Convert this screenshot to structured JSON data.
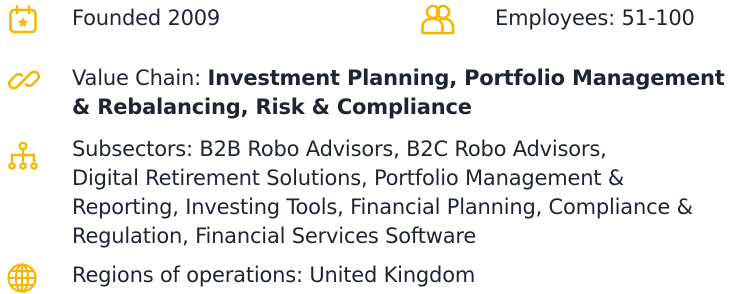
{
  "accent_color": "#f5b800",
  "founded": {
    "icon": "calendar-icon",
    "text": "Founded 2009"
  },
  "employees": {
    "icon": "people-icon",
    "text": "Employees: 51-100"
  },
  "value_chain": {
    "icon": "link-icon",
    "label": "Value Chain:",
    "value_line1": "Investment Planning, Portfolio Management",
    "value_line2": "& Rebalancing, Risk & Compliance"
  },
  "subsectors": {
    "icon": "hierarchy-icon",
    "lines": [
      "Subsectors: B2B Robo Advisors, B2C Robo Advisors,",
      "Digital Retirement Solutions, Portfolio Management &",
      "Reporting, Investing Tools, Financial Planning, Compliance &",
      "Regulation, Financial Services Software"
    ]
  },
  "regions": {
    "icon": "globe-icon",
    "text": "Regions of operations: United Kingdom"
  }
}
